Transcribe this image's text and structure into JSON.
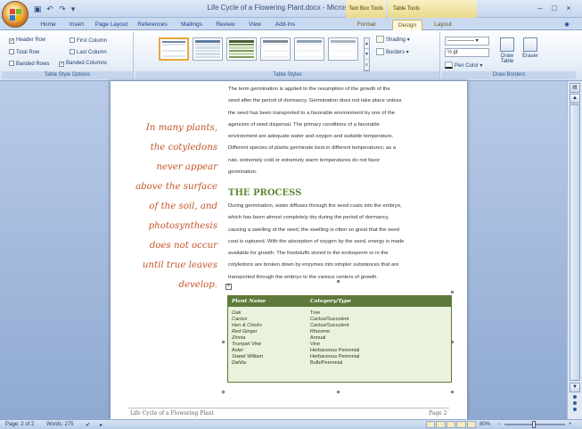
{
  "window": {
    "title": "Life Cycle of a Flowering Plant.docx - Microsoft Word",
    "context_tab_groups": [
      "Text Box Tools",
      "Table Tools"
    ],
    "controls": {
      "minimize": "–",
      "maximize": "□",
      "close": "×"
    }
  },
  "tabs": [
    "Home",
    "Insert",
    "Page Layout",
    "References",
    "Mailings",
    "Review",
    "View",
    "Add-Ins",
    "Format",
    "Design",
    "Layout"
  ],
  "active_tab": "Design",
  "ribbon": {
    "table_style_options": {
      "label": "Table Style Options",
      "options": [
        {
          "label": "Header Row",
          "checked": true
        },
        {
          "label": "First Column",
          "checked": false
        },
        {
          "label": "Total Row",
          "checked": false
        },
        {
          "label": "Last Column",
          "checked": false
        },
        {
          "label": "Banded Rows",
          "checked": false
        },
        {
          "label": "Banded Columns",
          "checked": true
        }
      ]
    },
    "table_styles": {
      "label": "Table Styles",
      "shading": "Shading",
      "borders": "Borders"
    },
    "draw_borders": {
      "label": "Draw Borders",
      "pen_weight": "½ pt",
      "pen_color": "Pen Color",
      "draw_table": "Draw Table",
      "eraser": "Eraser"
    }
  },
  "document": {
    "pull_quote": [
      "In many plants,",
      "the cotyledons",
      "never appear",
      "above the surface",
      "of the soil, and",
      "photosynthesis",
      "does not occur",
      "until true leaves",
      "develop."
    ],
    "paragraph1": [
      "The term germination is applied to the resumption of the growth of the",
      "seed after the period of dormancy. Germination does not take place unless",
      "the seed has been transported to a favorable environment by one of the",
      "agencies of seed dispersal. The primary conditions of a favorable",
      "environment are adequate water and oxygen and suitable temperature.",
      "Different species of plants germinate best in different temperatures; as a",
      "rule, extremely cold or extremely warm temperatures do not favor",
      "germination."
    ],
    "heading": "THE PROCESS",
    "paragraph2": [
      "During germination, water diffuses through the seed coats into the embryo,",
      "which has been almost completely dry during the period of dormancy,",
      "causing a swelling of the seed; the swelling is often so great that the seed",
      "coat is ruptured. With the absorption of oxygen by the seed, energy is made",
      "available for growth. The foodstuffs stored in the endosperm or in the",
      "cotyledons are broken down by enzymes into simpler substances that are",
      "transported through the embryo to the various centers of growth."
    ],
    "table": {
      "headers": [
        "Plant Name",
        "Category/Type"
      ],
      "rows": [
        [
          "Oak",
          "Tree"
        ],
        [
          "Cactus",
          "Cactus/Succulent"
        ],
        [
          "Hen & Chicks",
          "Cactus/Succulent"
        ],
        [
          "Red Ginger",
          "Rhizome"
        ],
        [
          "Zinnia",
          "Annual"
        ],
        [
          "Trumpet Vine",
          "Vine"
        ],
        [
          "Aster",
          "Herbaceous Perennial"
        ],
        [
          "Sweet William",
          "Herbaceous Perennial"
        ],
        [
          "Dahlia",
          "Bulb/Perennial"
        ]
      ]
    },
    "footer_left": "Life Cycle of a Flowering Plant",
    "footer_right": "Page 2"
  },
  "statusbar": {
    "page": "Page: 2 of 2",
    "words": "Words: 275",
    "zoom": "80%"
  },
  "colors": {
    "accent_orange": "#c4542a",
    "heading_green": "#5d8a36",
    "table_header": "#5e7a3b",
    "ribbon_blue": "#c9daf0"
  }
}
